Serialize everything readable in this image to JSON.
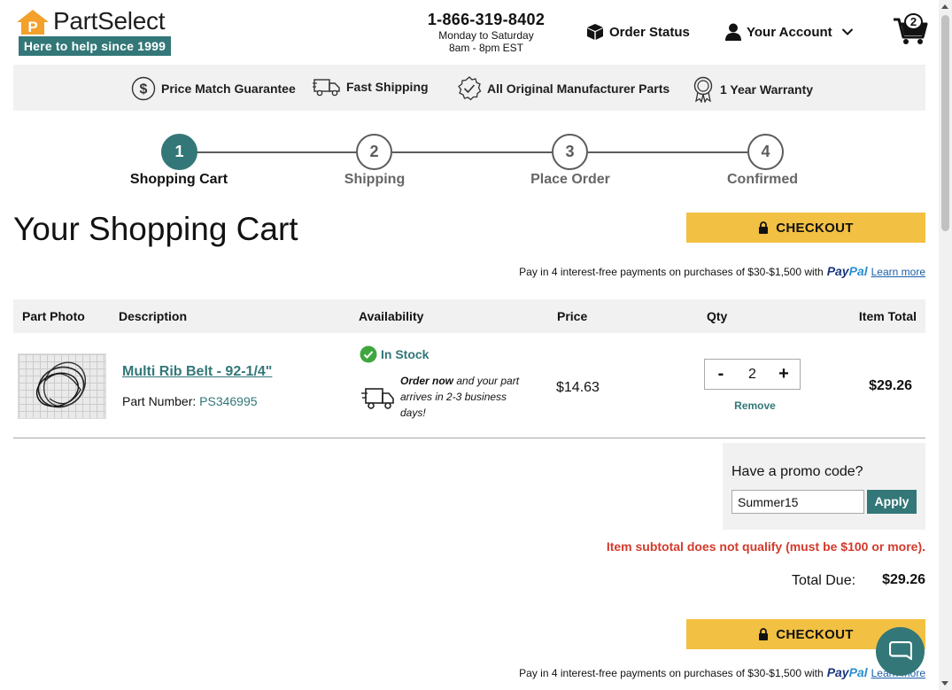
{
  "header": {
    "brand": "PartSelect",
    "tagline": "Here to help since 1999",
    "phone": "1-866-319-8402",
    "hours_days": "Monday to Saturday",
    "hours_time": "8am - 8pm EST",
    "order_status": "Order Status",
    "account": "Your Account",
    "cart_count": "2"
  },
  "benefits": [
    "Price Match Guarantee",
    "Fast Shipping",
    "All Original Manufacturer Parts",
    "1 Year Warranty"
  ],
  "steps": [
    {
      "num": "1",
      "label": "Shopping Cart"
    },
    {
      "num": "2",
      "label": "Shipping"
    },
    {
      "num": "3",
      "label": "Place Order"
    },
    {
      "num": "4",
      "label": "Confirmed"
    }
  ],
  "cart": {
    "title": "Your Shopping Cart",
    "checkout_label": "CHECKOUT",
    "paypal_text": "Pay in 4 interest-free payments on purchases of $30-$1,500 with",
    "paypal_brand_1": "Pay",
    "paypal_brand_2": "Pal",
    "learn_more": "Learn more",
    "columns": [
      "Part Photo",
      "Description",
      "Availability",
      "Price",
      "Qty",
      "Item Total"
    ],
    "item": {
      "name": "Multi Rib Belt - 92-1/4\"",
      "part_number_label": "Part Number:",
      "part_number": "PS346995",
      "stock": "In Stock",
      "ship_bold": "Order now",
      "ship_rest": " and your part arrives in 2-3 business days!",
      "price": "$14.63",
      "qty": "2",
      "qty_minus": "-",
      "qty_plus": "+",
      "remove": "Remove",
      "total": "$29.26"
    },
    "promo_title": "Have a promo code?",
    "promo_value": "Summer15",
    "promo_apply": "Apply",
    "promo_error": "Item subtotal does not qualify (must be $100 or more).",
    "total_label": "Total Due:",
    "total_value": "$29.26"
  },
  "colors": {
    "brand_teal": "#337778",
    "checkout_yellow": "#f2c042",
    "logo_orange": "#f3a12b",
    "error_red": "#d33a2c"
  }
}
